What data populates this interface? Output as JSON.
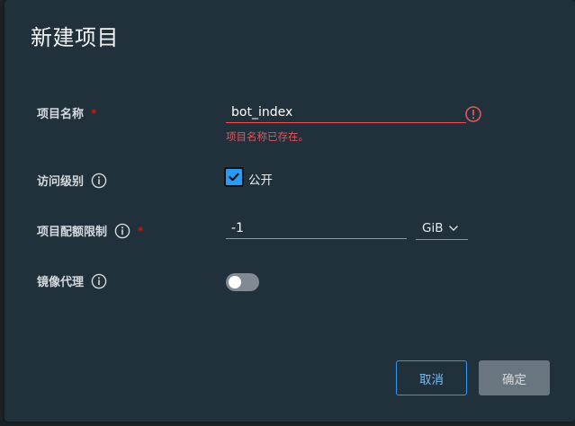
{
  "dialog": {
    "title": "新建项目"
  },
  "form": {
    "project_name": {
      "label": "项目名称",
      "required_mark": "*",
      "value": "bot_index",
      "error": "项目名称已存在。"
    },
    "access_level": {
      "label": "访问级别",
      "checkbox_label": "公开",
      "checked": true
    },
    "quota": {
      "label": "项目配额限制",
      "required_mark": "*",
      "value": "-1",
      "unit": "GiB"
    },
    "proxy_cache": {
      "label": "镜像代理",
      "enabled": false
    }
  },
  "buttons": {
    "cancel": "取消",
    "confirm": "确定"
  },
  "colors": {
    "dialog_bg": "#21313b",
    "error": "#e0575b",
    "accent": "#2b9af3",
    "disabled_button": "#6a767f"
  }
}
